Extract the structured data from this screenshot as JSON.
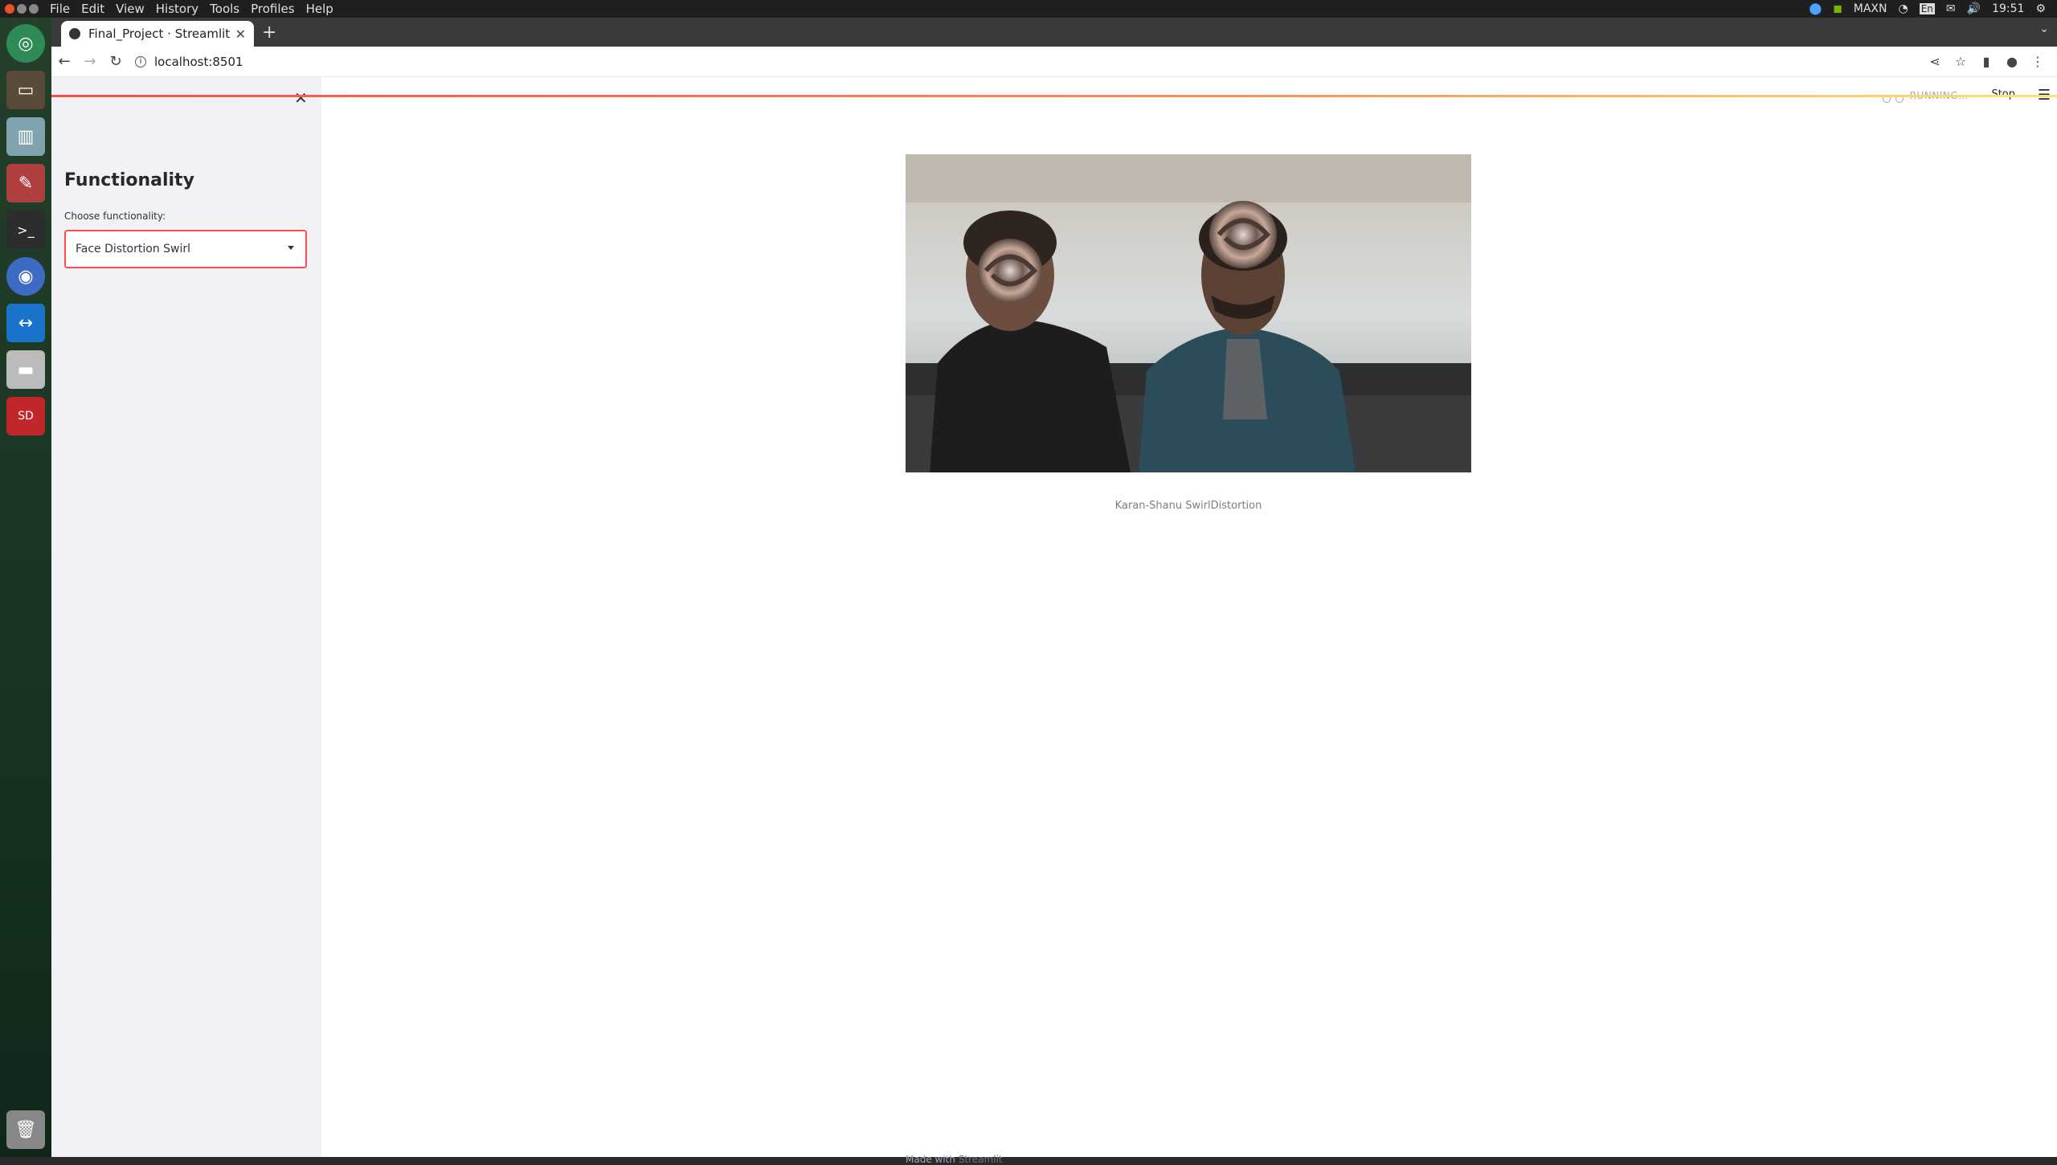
{
  "system_bar": {
    "menus": [
      "File",
      "Edit",
      "View",
      "History",
      "Tools",
      "Profiles",
      "Help"
    ],
    "tray": {
      "profile": "MAXN",
      "lang": "En",
      "time": "19:51"
    }
  },
  "launcher": {
    "apps": [
      "ubuntu-icon",
      "files-icon",
      "trash-bag-icon",
      "settings-icon",
      "terminal-icon",
      "chromium-icon",
      "teamviewer-icon",
      "drive-icon",
      "sd-card-icon",
      "trash-icon"
    ]
  },
  "browser": {
    "tab_title": "Final_Project · Streamlit",
    "url": "localhost:8501"
  },
  "sidebar": {
    "title": "Functionality",
    "select_label": "Choose functionality:",
    "select_value": "Face Distortion Swirl"
  },
  "main": {
    "status_text": "RUNNING...",
    "stop_label": "Stop",
    "image_caption": "Karan-Shanu SwirlDistortion",
    "footer_prefix": "Made with",
    "footer_brand": "Streamlit"
  },
  "colors": {
    "accent": "#ff4b4b",
    "sidebar_bg": "#f0f2f6"
  }
}
